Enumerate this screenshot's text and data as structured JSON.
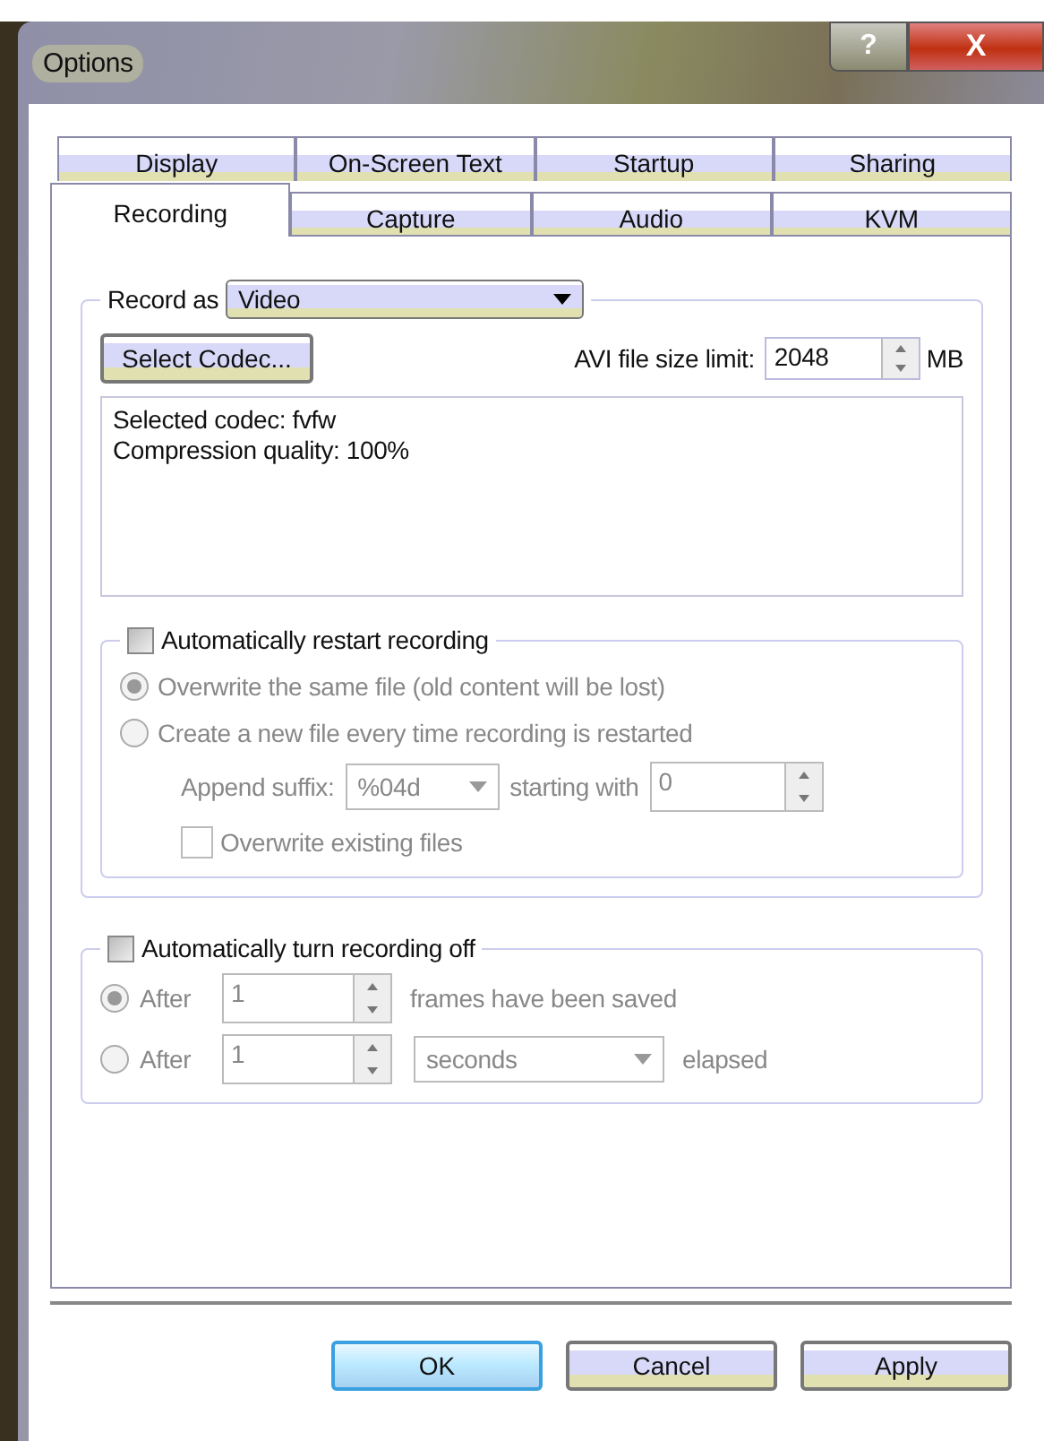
{
  "window": {
    "title": "Options",
    "help_button": "?",
    "close_button": "X"
  },
  "tab_rows": [
    [
      {
        "label": "Display",
        "selected": false
      },
      {
        "label": "On-Screen Text",
        "selected": false
      },
      {
        "label": "Startup",
        "selected": false
      },
      {
        "label": "Sharing",
        "selected": false
      }
    ],
    [
      {
        "label": "Recording",
        "selected": true
      },
      {
        "label": "Capture",
        "selected": false
      },
      {
        "label": "Audio",
        "selected": false
      },
      {
        "label": "KVM",
        "selected": false
      }
    ]
  ],
  "record_as": {
    "label": "Record as",
    "value": "Video"
  },
  "select_codec_button": "Select Codec...",
  "file_size_limit": {
    "label": "AVI file size limit:",
    "value": "2048",
    "unit": "MB"
  },
  "codec_info": [
    "Selected codec: fvfw",
    "Compression quality: 100%"
  ],
  "restart_group": {
    "label": "Automatically restart recording",
    "checked": false,
    "disabled": true,
    "radios": [
      {
        "label": "Overwrite the same file (old content will be lost)",
        "selected": true
      },
      {
        "label": "Create a new file every time recording is restarted",
        "selected": false
      }
    ],
    "suffix_label": "Append suffix:",
    "suffix_value": "%04d",
    "starting_label": "starting with",
    "starting_value": "0",
    "overwrite_existing": {
      "label": "Overwrite existing files",
      "checked": false
    }
  },
  "off_group": {
    "label": "Automatically turn recording off",
    "checked": false,
    "disabled": true,
    "rows": [
      {
        "kind": "frames",
        "label": "After",
        "value": "1",
        "selected": true,
        "text": "frames have been saved"
      },
      {
        "kind": "time",
        "label": "After",
        "value": "1",
        "selected": false,
        "unit": "seconds",
        "text": "elapsed"
      }
    ]
  },
  "buttons": [
    {
      "label": "OK",
      "kind": "default"
    },
    {
      "label": "Cancel",
      "kind": "normal"
    },
    {
      "label": "Apply",
      "kind": "normal"
    }
  ]
}
